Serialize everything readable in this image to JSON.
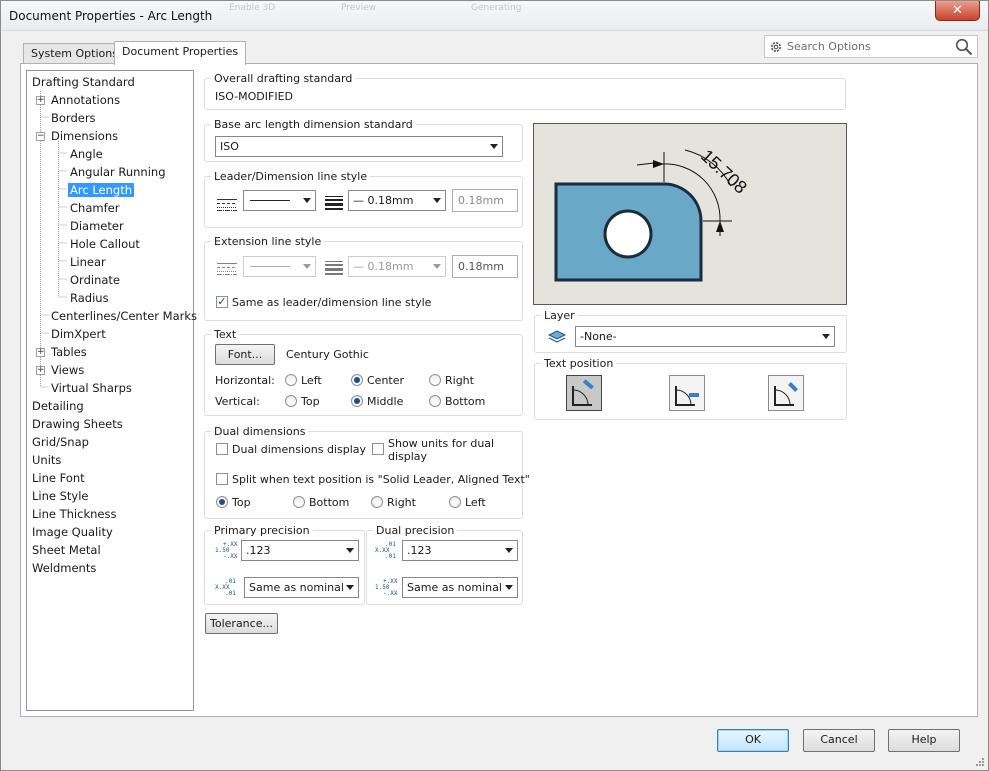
{
  "window": {
    "title": "Document Properties - Arc Length",
    "close_glyph": "✕",
    "ghost_labels": [
      "Enable 3D",
      "Preview",
      "Generating"
    ]
  },
  "tabs": [
    {
      "label": "System Options",
      "active": false
    },
    {
      "label": "Document Properties",
      "active": true
    }
  ],
  "search": {
    "placeholder": "Search Options"
  },
  "tree": [
    {
      "label": "Drafting Standard",
      "level": 0,
      "expander": ""
    },
    {
      "label": "Annotations",
      "level": 1,
      "expander": "+"
    },
    {
      "label": "Borders",
      "level": 1,
      "expander": ""
    },
    {
      "label": "Dimensions",
      "level": 1,
      "expander": "−"
    },
    {
      "label": "Angle",
      "level": 2,
      "expander": ""
    },
    {
      "label": "Angular Running",
      "level": 2,
      "expander": ""
    },
    {
      "label": "Arc Length",
      "level": 2,
      "expander": "",
      "selected": true
    },
    {
      "label": "Chamfer",
      "level": 2,
      "expander": ""
    },
    {
      "label": "Diameter",
      "level": 2,
      "expander": ""
    },
    {
      "label": "Hole Callout",
      "level": 2,
      "expander": ""
    },
    {
      "label": "Linear",
      "level": 2,
      "expander": ""
    },
    {
      "label": "Ordinate",
      "level": 2,
      "expander": ""
    },
    {
      "label": "Radius",
      "level": 2,
      "expander": ""
    },
    {
      "label": "Centerlines/Center Marks",
      "level": 1,
      "expander": ""
    },
    {
      "label": "DimXpert",
      "level": 1,
      "expander": ""
    },
    {
      "label": "Tables",
      "level": 1,
      "expander": "+"
    },
    {
      "label": "Views",
      "level": 1,
      "expander": "+"
    },
    {
      "label": "Virtual Sharps",
      "level": 1,
      "expander": ""
    },
    {
      "label": "Detailing",
      "level": 0,
      "expander": ""
    },
    {
      "label": "Drawing Sheets",
      "level": 0,
      "expander": ""
    },
    {
      "label": "Grid/Snap",
      "level": 0,
      "expander": ""
    },
    {
      "label": "Units",
      "level": 0,
      "expander": ""
    },
    {
      "label": "Line Font",
      "level": 0,
      "expander": ""
    },
    {
      "label": "Line Style",
      "level": 0,
      "expander": ""
    },
    {
      "label": "Line Thickness",
      "level": 0,
      "expander": ""
    },
    {
      "label": "Image Quality",
      "level": 0,
      "expander": ""
    },
    {
      "label": "Sheet Metal",
      "level": 0,
      "expander": ""
    },
    {
      "label": "Weldments",
      "level": 0,
      "expander": ""
    }
  ],
  "overall": {
    "label": "Overall drafting standard",
    "value": "ISO-MODIFIED"
  },
  "base_arc": {
    "label": "Base arc length dimension standard",
    "value": "ISO"
  },
  "leader_style": {
    "label": "Leader/Dimension line style",
    "thickness": "— 0.18mm",
    "custom": "0.18mm"
  },
  "extension_style": {
    "label": "Extension line style",
    "thickness": "— 0.18mm",
    "custom": "0.18mm",
    "same_as": "Same as leader/dimension line style",
    "same_as_checked": true
  },
  "text": {
    "label": "Text",
    "font_button": "Font...",
    "font_name": "Century Gothic",
    "horizontal_label": "Horizontal:",
    "vertical_label": "Vertical:",
    "horizontal_options": [
      "Left",
      "Center",
      "Right"
    ],
    "horizontal_selected": 1,
    "vertical_options": [
      "Top",
      "Middle",
      "Bottom"
    ],
    "vertical_selected": 1
  },
  "dual": {
    "label": "Dual dimensions",
    "dual_display": "Dual dimensions display",
    "show_units_1": "Show units for dual",
    "show_units_2": "display",
    "split": "Split when text position is \"Solid Leader, Aligned Text\"",
    "positions": [
      "Top",
      "Bottom",
      "Right",
      "Left"
    ],
    "position_selected": 0
  },
  "primary_precision": {
    "label": "Primary precision",
    "value": ".123",
    "tolerance": "Same as nominal"
  },
  "dual_precision": {
    "label": "Dual precision",
    "value": ".123",
    "tolerance": "Same as nominal"
  },
  "tolerance_button": "Tolerance...",
  "preview": {
    "dimension_text": "15.708",
    "shape_color": "#6aa8c8"
  },
  "layer": {
    "label": "Layer",
    "value": "-None-"
  },
  "text_position": {
    "label": "Text position",
    "selected": 0
  },
  "footer": {
    "ok": "OK",
    "cancel": "Cancel",
    "help": "Help"
  },
  "precision_icon": {
    "top": "+.XX",
    "mid": "1.50",
    "bot": "-.XX",
    "t2": ".01",
    "m2": "X.XX",
    "b2": ".01"
  }
}
